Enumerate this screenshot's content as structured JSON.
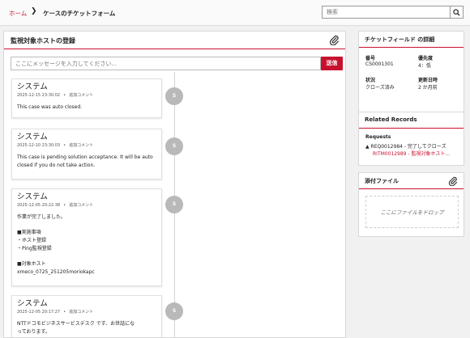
{
  "breadcrumb": {
    "home": "ホーム",
    "separator": "❯",
    "current": "ケースのチケットフォーム"
  },
  "search": {
    "placeholder": "検索"
  },
  "main": {
    "title": "監視対象ホストの登録",
    "message_placeholder": "ここにメッセージを入力してください...",
    "send_label": "送信",
    "entries": [
      {
        "author": "システム",
        "timestamp": "2025-12-15 23:30:02",
        "type": "追加コメント",
        "avatar": "S",
        "lines": [
          "This case was auto closed."
        ]
      },
      {
        "author": "システム",
        "timestamp": "2025-12-10 23:30:03",
        "type": "追加コメント",
        "avatar": "S",
        "lines": [
          "This case is pending solution acceptance. It will be auto",
          "closed if you do not take action."
        ]
      },
      {
        "author": "システム",
        "timestamp": "2025-12-05 20:22:38",
        "type": "追加コメント",
        "avatar": "S",
        "lines": [
          "作業が完了しました。",
          "",
          "■実施事項",
          "・ホスト登録",
          "・Ping監視登録",
          "",
          "■対象ホスト",
          "xmeco_0725_251205moriokapc"
        ]
      },
      {
        "author": "システム",
        "timestamp": "2025-12-05 20:17:27",
        "type": "追加コメント",
        "avatar": "S",
        "lines": [
          "NTTドコモビジネスサービスデスク です、お世話にな",
          "っております。"
        ]
      }
    ]
  },
  "ticket_fields": {
    "title": "チケットフィールド の詳細",
    "number_label": "番号",
    "number_value": "CS0001301",
    "priority_label": "優先度",
    "priority_value": "4：低",
    "status_label": "状況",
    "status_value": "クローズ済み",
    "updated_label": "更新日時",
    "updated_value": "2 か月前"
  },
  "related": {
    "title": "Related Records",
    "requests_label": "Requests",
    "item1": "REQ0012984 - 完了してクローズ",
    "item2": "RITM0012989 - 監視対象ホスト..."
  },
  "attachments": {
    "title": "添付ファイル",
    "drop_text": "ここにファイルをドロップ"
  },
  "colors": {
    "accent": "#c8102e",
    "avatar": "#b9b9b9",
    "background": "#f1f1f1"
  }
}
